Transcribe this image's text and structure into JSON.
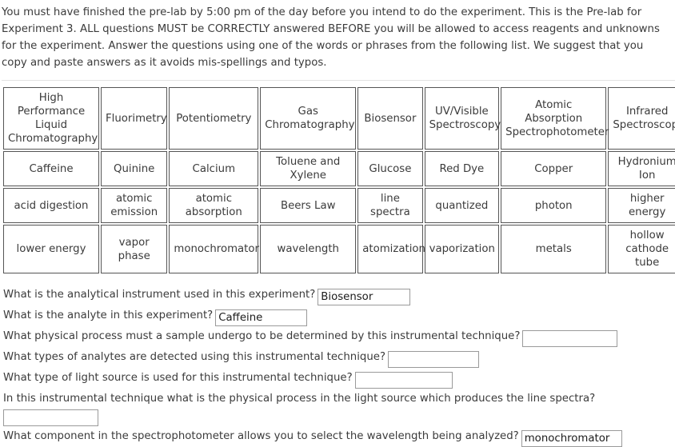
{
  "intro": {
    "paragraph": "You must have finished the pre-lab by 5:00 pm of the day before you intend to do the experiment. This is the Pre-lab for Experiment 3. ALL questions MUST be CORRECTLY answered BEFORE you will be allowed to access reagents and unknowns for the experiment. Answer the questions using one of the words or phrases from the following list. We suggest that you copy and paste answers as it avoids mis-spellings and typos."
  },
  "wordbank": {
    "rows": [
      [
        "High Performance Liquid Chromatography",
        "Fluorimetry",
        "Potentiometry",
        "Gas Chromatography",
        "Biosensor",
        "UV/Visible Spectroscopy",
        "Atomic Absorption Spectrophotometer",
        "Infrared Spectroscopy"
      ],
      [
        "Caffeine",
        "Quinine",
        "Calcium",
        "Toluene and Xylene",
        "Glucose",
        "Red Dye",
        "Copper",
        "Hydronium Ion"
      ],
      [
        "acid digestion",
        "atomic emission",
        "atomic absorption",
        "Beers Law",
        "line spectra",
        "quantized",
        "photon",
        "higher energy"
      ],
      [
        "lower energy",
        "vapor phase",
        "monochromator",
        "wavelength",
        "atomization",
        "vaporization",
        "metals",
        "hollow cathode tube"
      ]
    ]
  },
  "questions": [
    {
      "label": "What is the analytical instrument used in this experiment?",
      "value": "Biosensor",
      "placeholder": "",
      "width_class": "w-114",
      "wrapped": false
    },
    {
      "label": "What is the analyte in this experiment?",
      "value": "Caffeine",
      "placeholder": "",
      "width_class": "w-113",
      "wrapped": false
    },
    {
      "label": "What physical process must a sample undergo to be determined by this instrumental technique?",
      "value": "",
      "placeholder": "",
      "width_class": "w-117",
      "wrapped": false
    },
    {
      "label": "What types of analytes are detected using this instrumental technique?",
      "value": "",
      "placeholder": "",
      "width_class": "w-112",
      "wrapped": false
    },
    {
      "label": "What type of light source is used for this instrumental technique?",
      "value": "",
      "placeholder": "",
      "width_class": "w-120",
      "wrapped": false
    },
    {
      "label": "In this instrumental technique what is the physical process in the light source which produces the line spectra?",
      "value": "",
      "placeholder": "",
      "width_class": "w-117",
      "wrapped": true
    },
    {
      "label": "What component in the spectrophotometer allows you to select the wavelength being analyzed?",
      "value": "monochromator",
      "placeholder": "",
      "width_class": "w-124",
      "wrapped": false
    }
  ]
}
